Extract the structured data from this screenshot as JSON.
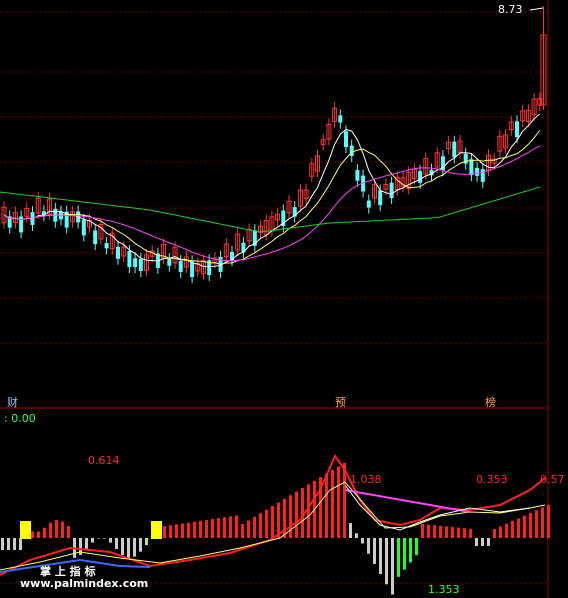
{
  "main_chart": {
    "high_label": "8.73",
    "colors": {
      "up": "#ff3333",
      "down": "#54ffff",
      "ma5": "#ffffff",
      "ma10": "#ffff66",
      "ma20": "#ff44ff",
      "ma60": "#22cc22",
      "grid": "#7a0000"
    }
  },
  "markers": [
    {
      "text": "财",
      "color": "#8fc3ff"
    },
    {
      "text": "预",
      "color": "#ffa040"
    },
    {
      "text": "榜",
      "color": "#ffa040"
    }
  ],
  "indicator": {
    "zero_label": ": 0.00",
    "labels": [
      {
        "text": "0.614",
        "color": "#ff2a2a"
      },
      {
        "text": "1.038",
        "color": "#ff2a2a"
      },
      {
        "text": "0.353",
        "color": "#ff2a2a"
      },
      {
        "text": "0.57",
        "color": "#ff2a2a"
      },
      {
        "text": "1.353",
        "color": "#33ff33"
      }
    ]
  },
  "watermark": {
    "cn": "掌 上 指 标",
    "url": "www.palmindex.com"
  }
}
